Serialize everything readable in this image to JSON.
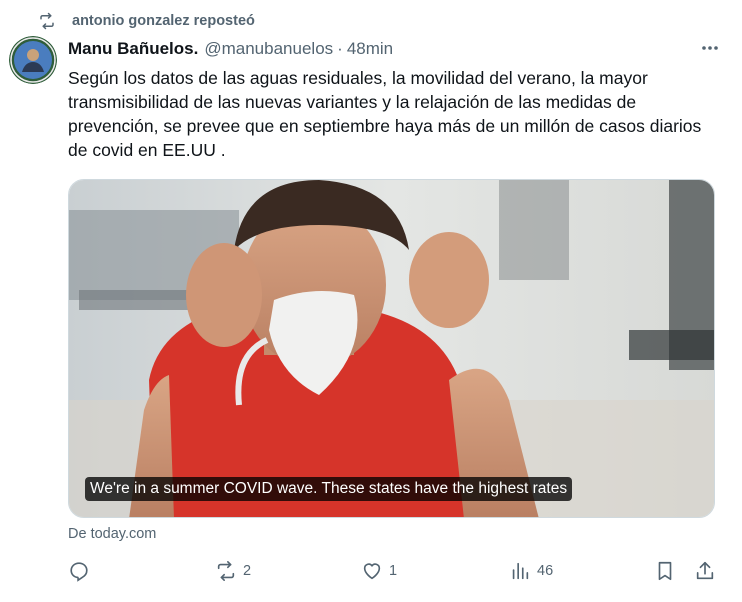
{
  "repost": {
    "text": "antonio gonzalez reposteó",
    "icon": "repost-icon"
  },
  "author": {
    "display_name": "Manu Bañuelos.",
    "handle": "@manubanuelos",
    "separator": "·",
    "time": "48min"
  },
  "tweet": {
    "text": "Según los datos de las aguas residuales, la movilidad del verano, la mayor transmisibilidad de las nuevas variantes y la relajación de las medidas de prevención, se prevee que en septiembre haya más de un millón de casos diarios de covid en EE.UU ."
  },
  "media": {
    "caption": "We're in a summer COVID wave. These states have the highest rates",
    "source": "De today.com"
  },
  "actions": {
    "reply": {
      "icon": "reply-icon",
      "count": ""
    },
    "repost": {
      "icon": "repost-icon",
      "count": "2"
    },
    "like": {
      "icon": "heart-icon",
      "count": "1"
    },
    "views": {
      "icon": "views-icon",
      "count": "46"
    },
    "bookmark": {
      "icon": "bookmark-icon"
    },
    "share": {
      "icon": "share-icon"
    }
  },
  "colors": {
    "text": "#0f1419",
    "secondary": "#536471",
    "border": "#cfd9de"
  }
}
